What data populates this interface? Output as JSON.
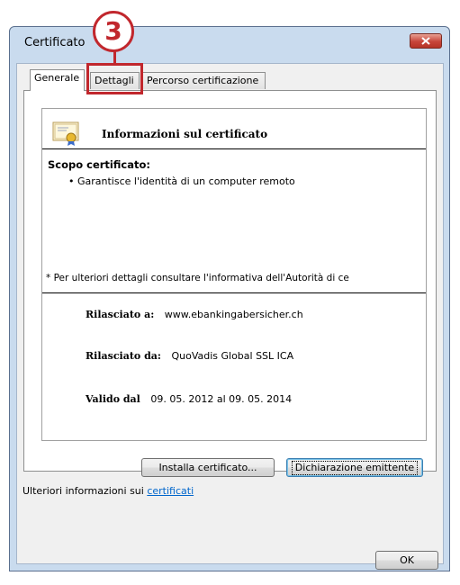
{
  "window": {
    "title": "Certificato"
  },
  "tabs": [
    {
      "label": "Generale"
    },
    {
      "label": "Dettagli"
    },
    {
      "label": "Percorso certificazione"
    }
  ],
  "annotation": {
    "step_number": "3"
  },
  "cert": {
    "heading": "Informazioni sul certificato",
    "scope_title": "Scopo certificato:",
    "scope_item": "• Garantisce l'identità di un computer remoto",
    "note": "* Per ulteriori dettagli consultare l'informativa dell'Autorità di ce",
    "issued_to_label": "Rilasciato a:",
    "issued_to_value": "www.ebankingabersicher.ch",
    "issued_by_label": "Rilasciato da:",
    "issued_by_value": "QuoVadis Global SSL ICA",
    "valid_label": "Valido dal",
    "valid_value": "09. 05. 2012  al  09. 05. 2014"
  },
  "buttons": {
    "install": "Installa certificato...",
    "statement": "Dichiarazione emittente",
    "ok": "OK"
  },
  "info": {
    "text": "Ulteriori informazioni sui ",
    "link": "certificati"
  },
  "colors": {
    "annotation_red": "#c1272d",
    "link_blue": "#0066cc"
  }
}
